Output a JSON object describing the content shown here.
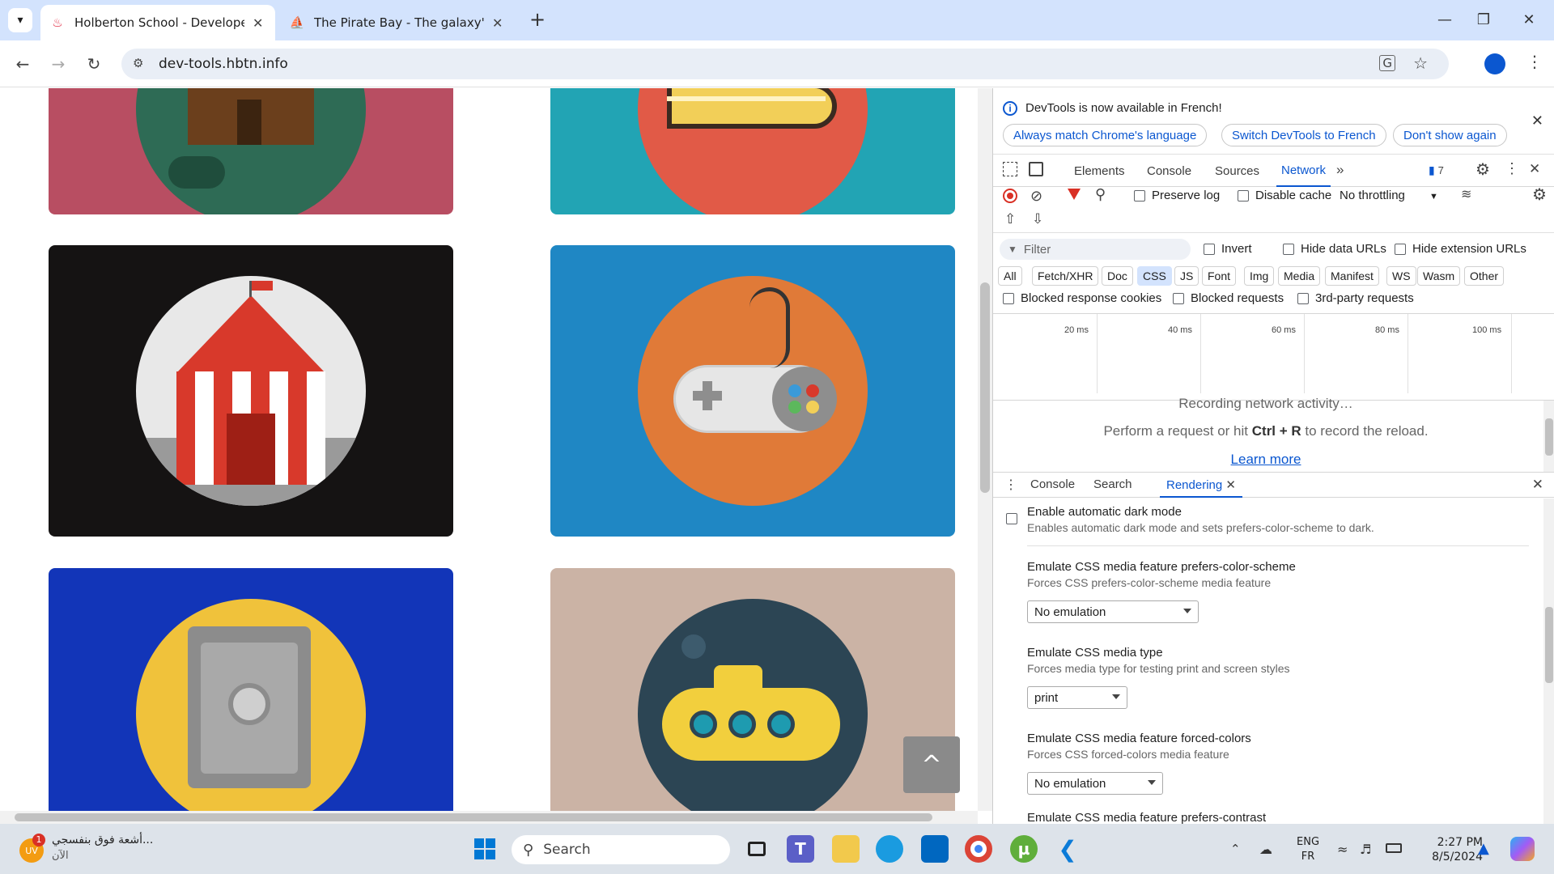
{
  "browser": {
    "tabs": [
      {
        "title": "Holberton School - Developer t",
        "active": true
      },
      {
        "title": "The Pirate Bay - The galaxy's m",
        "active": false
      }
    ],
    "new_tab": "+",
    "url": "dev-tools.hbtn.info"
  },
  "page": {
    "scroll_top_icon": "^"
  },
  "devtools": {
    "infobar": {
      "message": "DevTools is now available in French!",
      "btn_match": "Always match Chrome's language",
      "btn_switch": "Switch DevTools to French",
      "btn_dont": "Don't show again"
    },
    "tabs": [
      "Elements",
      "Console",
      "Sources",
      "Network"
    ],
    "active_tab": "Network",
    "issues_count": "7",
    "network": {
      "preserve_log": "Preserve log",
      "disable_cache": "Disable cache",
      "throttling": "No throttling",
      "filter_placeholder": "Filter",
      "invert": "Invert",
      "hide_data_urls": "Hide data URLs",
      "hide_extension_urls": "Hide extension URLs",
      "types": [
        "All",
        "Fetch/XHR",
        "Doc",
        "CSS",
        "JS",
        "Font",
        "Img",
        "Media",
        "Manifest",
        "WS",
        "Wasm",
        "Other"
      ],
      "active_type": "CSS",
      "blocked_cookies": "Blocked response cookies",
      "blocked_requests": "Blocked requests",
      "third_party": "3rd-party requests",
      "ticks": [
        "20 ms",
        "40 ms",
        "60 ms",
        "80 ms",
        "100 ms"
      ],
      "recording": "Recording network activity…",
      "perform_prefix": "Perform a request or hit ",
      "perform_keys": "Ctrl + R",
      "perform_suffix": " to record the reload.",
      "learn_more": "Learn more"
    },
    "drawer": {
      "tabs": [
        "Console",
        "Search",
        "Rendering"
      ],
      "active": "Rendering",
      "dark_mode_title": "Enable automatic dark mode",
      "dark_mode_desc": "Enables automatic dark mode and sets prefers-color-scheme to dark.",
      "color_scheme_title": "Emulate CSS media feature prefers-color-scheme",
      "color_scheme_desc": "Forces CSS prefers-color-scheme media feature",
      "color_scheme_value": "No emulation",
      "media_type_title": "Emulate CSS media type",
      "media_type_desc": "Forces media type for testing print and screen styles",
      "media_type_value": "print",
      "forced_colors_title": "Emulate CSS media feature forced-colors",
      "forced_colors_desc": "Forces CSS forced-colors media feature",
      "forced_colors_value": "No emulation",
      "contrast_title": "Emulate CSS media feature prefers-contrast"
    }
  },
  "taskbar": {
    "notification_text": "أشعة فوق بنفسجي...",
    "notification_sub": "الآن",
    "notification_badge": "1",
    "search_placeholder": "Search",
    "lang": "ENG",
    "lang_sub": "FR",
    "time": "2:27 PM",
    "date": "8/5/2024"
  }
}
